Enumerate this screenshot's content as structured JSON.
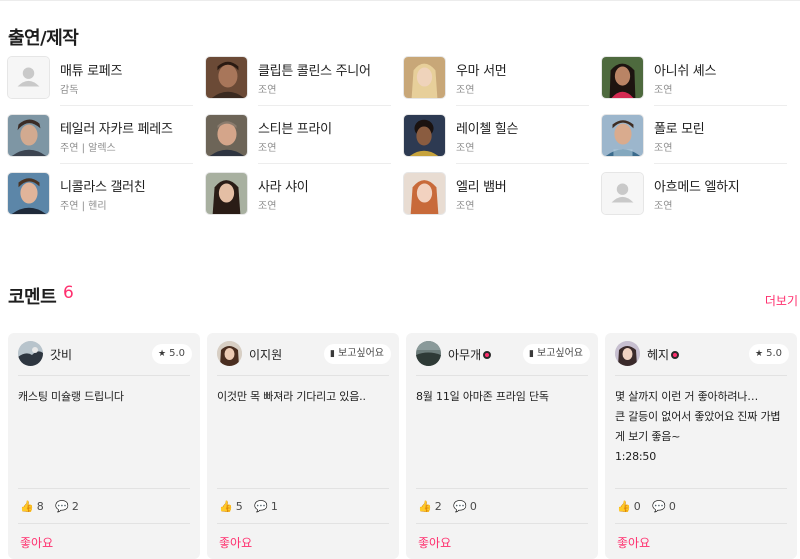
{
  "cast": {
    "title": "출연/제작",
    "people": [
      {
        "name": "매튜 로페즈",
        "role": "감독",
        "photo": "placeholder"
      },
      {
        "name": "클립튼 콜린스 주니어",
        "role": "조연",
        "photo": "photo"
      },
      {
        "name": "우마 서먼",
        "role": "조연",
        "photo": "photo"
      },
      {
        "name": "아니쉬 셰스",
        "role": "조연",
        "photo": "photo"
      },
      {
        "name": "테일러 자카르 페레즈",
        "role": "주연 | 알렉스",
        "photo": "photo"
      },
      {
        "name": "스티븐 프라이",
        "role": "조연",
        "photo": "photo"
      },
      {
        "name": "레이첼 힐슨",
        "role": "조연",
        "photo": "photo"
      },
      {
        "name": "폴로 모린",
        "role": "조연",
        "photo": "photo"
      },
      {
        "name": "니콜라스 갤러친",
        "role": "주연 | 헨리",
        "photo": "photo"
      },
      {
        "name": "사라 샤이",
        "role": "조연",
        "photo": "photo"
      },
      {
        "name": "엘리 뱀버",
        "role": "조연",
        "photo": "photo"
      },
      {
        "name": "아흐메드 엘하지",
        "role": "조연",
        "photo": "placeholder"
      }
    ]
  },
  "comments": {
    "title": "코멘트",
    "count": "6",
    "more_label": "더보기",
    "like_label": "좋아요",
    "items": [
      {
        "user": "갓비",
        "tag": "5.0",
        "tag_icon": "star-icon",
        "text": [
          "캐스팅 미슐랭 드립니다"
        ],
        "likes": "8",
        "replies": "2",
        "badge": false
      },
      {
        "user": "이지원",
        "tag": "보고싶어요",
        "tag_icon": "bookmark-icon",
        "text": [
          "이것만 목 빠져라 기다리고 있음.."
        ],
        "likes": "5",
        "replies": "1",
        "badge": false
      },
      {
        "user": "아무개",
        "tag": "보고싶어요",
        "tag_icon": "bookmark-icon",
        "text": [
          "8월 11일 아마존 프라임 단독"
        ],
        "likes": "2",
        "replies": "0",
        "badge": true
      },
      {
        "user": "헤지",
        "tag": "5.0",
        "tag_icon": "star-icon",
        "text": [
          "몇 살까지 이런 거 좋아하려나…",
          "큰 갈등이 없어서 좋았어요 진짜 가볍",
          "게 보기 좋음~",
          "1:28:50"
        ],
        "likes": "0",
        "replies": "0",
        "badge": true
      }
    ]
  },
  "colors": {
    "accent": "#ff2f6e",
    "card_bg": "#f3f3f3"
  }
}
